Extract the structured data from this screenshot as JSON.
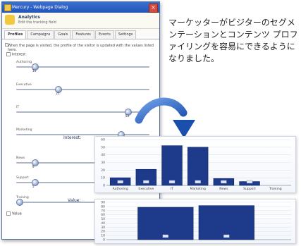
{
  "window": {
    "title": "Mercury - Webpage Dialog",
    "close_label": "×"
  },
  "header": {
    "title": "Analytics",
    "subtitle": "Edit the tracking field"
  },
  "tabs": [
    {
      "label": "Profiles",
      "active": true
    },
    {
      "label": "Campaigns",
      "active": false
    },
    {
      "label": "Goals",
      "active": false
    },
    {
      "label": "Features",
      "active": false
    },
    {
      "label": "Events",
      "active": false
    },
    {
      "label": "Settings",
      "active": false
    }
  ],
  "content": {
    "description": "When the page is visited, the profile of the visitor is updated with the values listed here.",
    "section_interest": "Interest",
    "section_value": "Value",
    "sliders": [
      {
        "label": "Authoring",
        "value": "10",
        "position": 0.13
      },
      {
        "label": "Executive",
        "value": "21",
        "position": 0.33
      },
      {
        "label": "IT",
        "value": "52",
        "position": 0.92
      },
      {
        "label": "Marketing",
        "value": "",
        "position": 0.86
      },
      {
        "label": "News",
        "value": "9",
        "position": 0.13
      },
      {
        "label": "Support",
        "value": "5",
        "position": 0.13
      },
      {
        "label": "Training",
        "value": "",
        "position": 0.0
      }
    ]
  },
  "caption": {
    "text": "マーケッターがビジターのセグメンテーションとコンテンツ プロファイリングを容易にできるようになりました。"
  },
  "colors": {
    "bar": "#1e3a8a",
    "bar_edge": "#0f2463",
    "arrow": "#1f5fbf",
    "title_bar": "#2255b8"
  },
  "chart_data": [
    {
      "type": "bar",
      "title": "Interest:",
      "categories": [
        "Authoring",
        "Executive",
        "IT",
        "Marketing",
        "News",
        "Support",
        "Training"
      ],
      "values": [
        10,
        21,
        52,
        50,
        9,
        5,
        0
      ],
      "ylim": [
        0,
        60
      ],
      "yticks": [
        0,
        10,
        20,
        30,
        40,
        50,
        60
      ]
    },
    {
      "type": "bar",
      "title": "Value:",
      "categories": [
        "",
        ""
      ],
      "values": [
        78,
        82
      ],
      "ylim": [
        0,
        90
      ],
      "yticks": [
        0,
        10,
        20,
        30,
        40,
        50,
        60,
        70,
        80,
        90
      ]
    }
  ]
}
